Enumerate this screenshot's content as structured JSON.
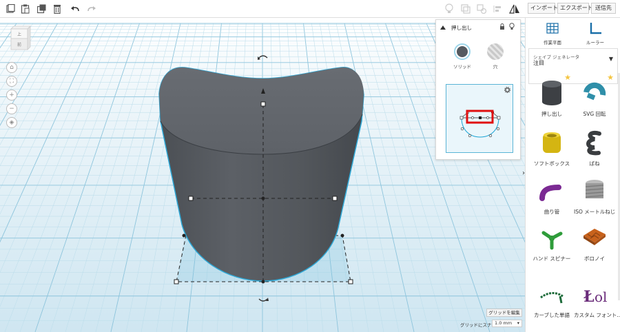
{
  "toolbar": {
    "undo_icon": "undo-arrow",
    "redo_icon": "redo-arrow"
  },
  "header": {
    "import_label": "インポート",
    "export_label": "エクスポート",
    "send_label": "送信先"
  },
  "tools": {
    "workplane_label": "作業平面",
    "ruler_label": "ルーラー"
  },
  "generator": {
    "caption": "シェイプ ジェネレータ",
    "selected": "注目"
  },
  "inspector": {
    "title": "押し出し",
    "solid_label": "ソリッド",
    "hole_label": "穴",
    "solid_color": "#555a60"
  },
  "navcube": {
    "top_face": "上",
    "front_face": "前"
  },
  "shapes": [
    {
      "name": "押し出し",
      "starred": true
    },
    {
      "name": "SVG 回転",
      "starred": true
    },
    {
      "name": "ソフトボックス",
      "starred": false
    },
    {
      "name": "ばね",
      "starred": false
    },
    {
      "name": "曲り管",
      "starred": false
    },
    {
      "name": "ISO メートルねじ",
      "starred": false
    },
    {
      "name": "ハンド スピナー",
      "starred": false
    },
    {
      "name": "ボロノイ",
      "starred": false
    },
    {
      "name": "カーブした単語",
      "starred": false
    },
    {
      "name": "カスタム フォント...",
      "starred": false
    }
  ],
  "bottom": {
    "edit_grid_label": "グリッドを編集",
    "snap_label": "グリッドにスナップ",
    "snap_value": "1.0 mm"
  },
  "colors": {
    "accent": "#1aa3d4",
    "grid_bg": "#e6f2f8",
    "highlight_box": "#e01010"
  }
}
